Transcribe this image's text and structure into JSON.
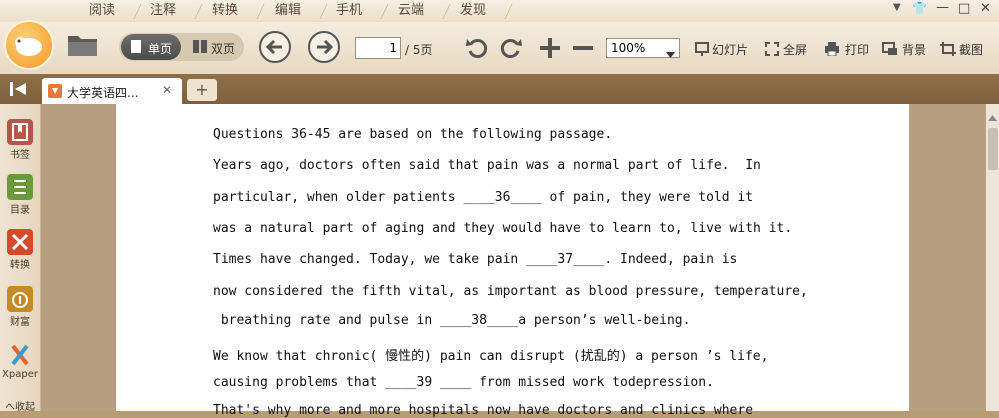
{
  "menu": {
    "tabs": [
      "阅读",
      "注释",
      "转换",
      "编辑",
      "手机",
      "云端",
      "发现"
    ]
  },
  "window_controls": [
    "▼",
    "👕",
    "—",
    "□",
    "✕"
  ],
  "toolbar": {
    "single_page": "单页",
    "double_page": "双页",
    "page_current": "1",
    "page_total": "/ 5页",
    "zoom": "100%",
    "slideshow": "幻灯片",
    "fullscreen": "全屏",
    "print": "打印",
    "background": "背景",
    "screenshot": "截图"
  },
  "tabs": {
    "active_title": "大学英语四...",
    "close": "✕",
    "add": "+"
  },
  "sidebar": {
    "items": [
      {
        "label": "书签",
        "icon": "bookmark-icon",
        "color": "#b5574b"
      },
      {
        "label": "目录",
        "icon": "outline-icon",
        "color": "#6a9a3a"
      },
      {
        "label": "转换",
        "icon": "convert-icon",
        "color": "#d64a2a"
      },
      {
        "label": "财富",
        "icon": "wealth-icon",
        "color": "#c48a2a"
      },
      {
        "label": "Xpaper",
        "icon": "xpaper-icon",
        "color": "#3a8ac4"
      }
    ],
    "collapse": "へ收起"
  },
  "document": {
    "lines": [
      "Questions 36-45 are based on the following passage.",
      "Years ago, doctors often said that pain was a normal part of life.  In",
      "particular, when older patients ____36____ of pain, they were told it",
      "was a natural part of aging and they would have to learn to, live with it.",
      "Times have changed. Today, we take pain ____37____. Indeed, pain is",
      "now considered the fifth vital, as important as blood pressure, temperature,",
      " breathing rate and pulse in ____38____a person’s well-being.",
      "We know that chronic( 慢性的) pain can disrupt (扰乱的) a person ’s life,",
      "causing problems that ____39 ____ from missed work todepression.",
      "That's why more and more hospitals now have doctors and clinics where"
    ]
  }
}
